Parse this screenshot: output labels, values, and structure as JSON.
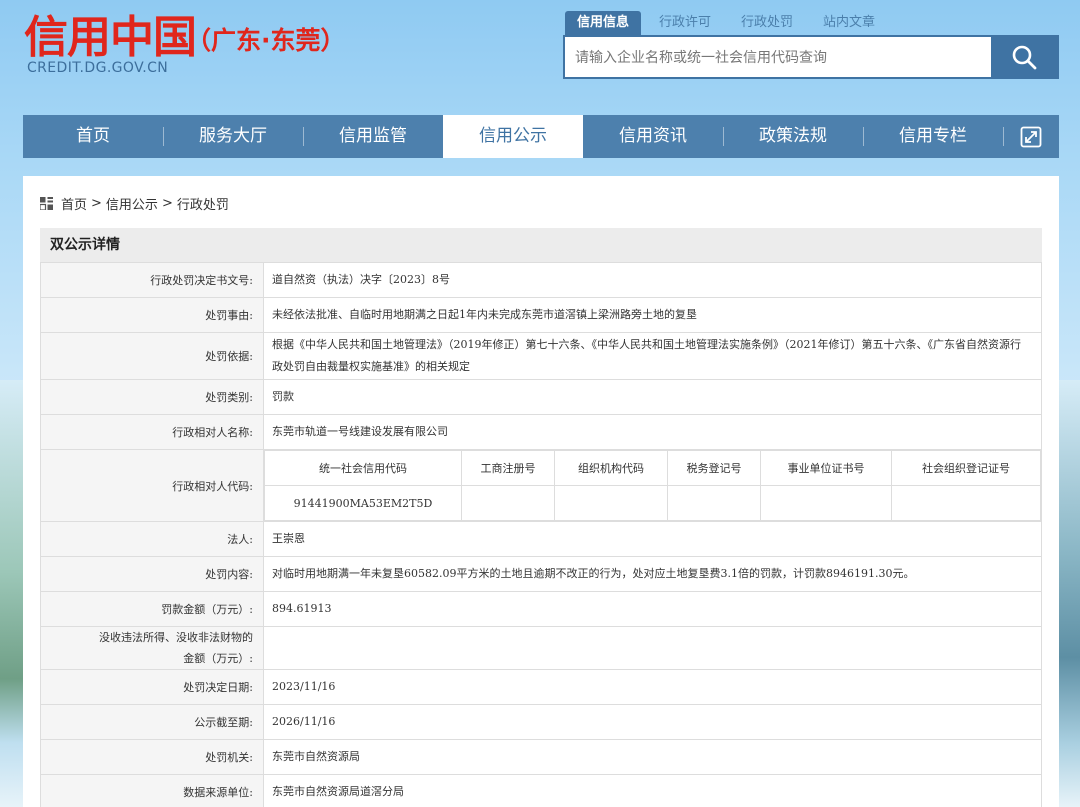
{
  "header": {
    "logo_main": "信用中国",
    "logo_region": "（广东·东莞）",
    "logo_domain": "CREDIT.DG.GOV.CN"
  },
  "search": {
    "tabs": [
      "信用信息",
      "行政许可",
      "行政处罚",
      "站内文章"
    ],
    "placeholder": "请输入企业名称或统一社会信用代码查询",
    "button_icon": "search-icon"
  },
  "nav": {
    "items": [
      "首页",
      "服务大厅",
      "信用监管",
      "信用公示",
      "信用资讯",
      "政策法规",
      "信用专栏"
    ],
    "active_index": 3,
    "expand_icon": "expand-icon"
  },
  "breadcrumb": {
    "icon": "grid-icon",
    "items": [
      "首页",
      "信用公示",
      "行政处罚"
    ],
    "separator": ">"
  },
  "section_title": "双公示详情",
  "detail": {
    "rows": [
      {
        "label": "行政处罚决定书文号:",
        "value": "道自然资（执法）决字〔2023〕8号"
      },
      {
        "label": "处罚事由:",
        "value": "未经依法批准、自临时用地期满之日起1年内未完成东莞市道滘镇上梁洲路旁土地的复垦"
      },
      {
        "label": "处罚依据:",
        "value": "根据《中华人民共和国土地管理法》（2019年修正）第七十六条、《中华人民共和国土地管理法实施条例》（2021年修订）第五十六条、《广东省自然资源行政处罚自由裁量权实施基准》的相关规定"
      },
      {
        "label": "处罚类别:",
        "value": "罚款"
      },
      {
        "label": "行政相对人名称:",
        "value": "东莞市轨道一号线建设发展有限公司"
      }
    ],
    "code_row": {
      "label": "行政相对人代码:",
      "headers": [
        "统一社会信用代码",
        "工商注册号",
        "组织机构代码",
        "税务登记号",
        "事业单位证书号",
        "社会组织登记证号"
      ],
      "values": [
        "91441900MA53EM2T5D",
        "",
        "",
        "",
        "",
        ""
      ]
    },
    "rows2": [
      {
        "label": "法人:",
        "value": "王崇恩"
      },
      {
        "label": "处罚内容:",
        "value": "对临时用地期满一年未复垦60582.09平方米的土地且逾期不改正的行为，处对应土地复垦费3.1倍的罚款，计罚款8946191.30元。"
      },
      {
        "label": "罚款金额（万元）:",
        "value": "894.61913"
      },
      {
        "label": "没收违法所得、没收非法财物的金额（万元）:",
        "value": ""
      },
      {
        "label": "处罚决定日期:",
        "value": "2023/11/16"
      },
      {
        "label": "公示截至期:",
        "value": "2026/11/16"
      },
      {
        "label": "处罚机关:",
        "value": "东莞市自然资源局"
      },
      {
        "label": "数据来源单位:",
        "value": "东莞市自然资源局道滘分局"
      }
    ]
  },
  "colors": {
    "brand_red": "#e0261c",
    "nav_blue": "#4d80ad",
    "accent_blue": "#3f73a3"
  }
}
